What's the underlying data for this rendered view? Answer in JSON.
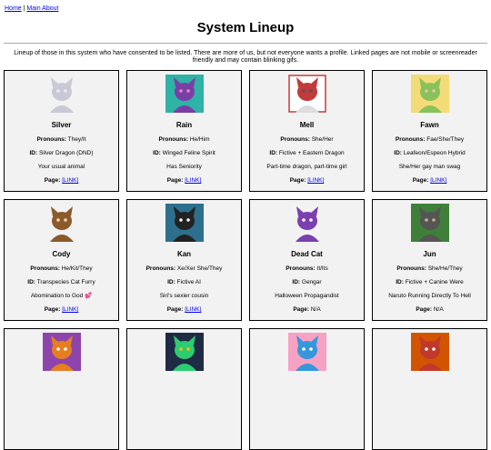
{
  "nav": {
    "home": "Home",
    "separator": "|",
    "main_about": "Main About"
  },
  "title": "System Lineup",
  "intro": "Lineup of those in this system who have consented to be listed. There are more of us, but not everyone wants a profile. Linked pages are not mobile or screenreader friendly and may contain blinking gifs.",
  "labels": {
    "pronouns": "Pronouns:",
    "id": "ID:",
    "page": "Page:"
  },
  "members": [
    {
      "name": "Silver",
      "pronouns": "They/It",
      "id": "Silver Dragon (DND)",
      "note": "Your usual animal",
      "page": "[LINK]",
      "page_is_link": true,
      "avatar_colors": [
        "#3b2f6e",
        "#c9c9d6",
        "#e8e8f0"
      ]
    },
    {
      "name": "Rain",
      "pronouns": "He/Him",
      "id": "Winged Feline Spirit",
      "note": "Has Seniority",
      "page": "[LINK]",
      "page_is_link": true,
      "avatar_colors": [
        "#2fb3a7",
        "#7a3fa6",
        "#e58ac0"
      ]
    },
    {
      "name": "Mell",
      "pronouns": "She/Her",
      "id": "Fictive + Eastern Dragon",
      "note": "Part-time dragon, part-time girl",
      "page": "[LINK]",
      "page_is_link": true,
      "avatar_colors": [
        "#ffffff",
        "#c23a3a",
        "#555555"
      ]
    },
    {
      "name": "Fawn",
      "pronouns": "Fae/She/They",
      "id": "Leafeon/Espeon Hybrid",
      "note": "She/Her gay man swag",
      "page": "[LINK]",
      "page_is_link": true,
      "avatar_colors": [
        "#f3dc77",
        "#8ac25a",
        "#e0c6a8"
      ]
    },
    {
      "name": "Cody",
      "pronouns": "He/Kit/They",
      "id": "Transpecies Cat Furry",
      "note": "Abomination to God 💕",
      "page": "[LINK]",
      "page_is_link": true,
      "avatar_colors": [
        "#c0392b",
        "#8b5a2b",
        "#f5d6b0"
      ]
    },
    {
      "name": "Kan",
      "pronouns": "Xe/Xer She/They",
      "id": "Fictive AI",
      "note": "Siri's sexier cousin",
      "page": "[LINK]",
      "page_is_link": true,
      "avatar_colors": [
        "#2e6f8e",
        "#222222",
        "#f2f2f2"
      ]
    },
    {
      "name": "Dead Cat",
      "pronouns": "It/Its",
      "id": "Gengar",
      "note": "Halloween Propagandist",
      "page": "N/A",
      "page_is_link": false,
      "avatar_colors": [
        "#5b2a86",
        "#7b3fb0",
        "#ffffff"
      ]
    },
    {
      "name": "Jun",
      "pronouns": "She/He/They",
      "id": "Fictive + Canine Were",
      "note": "Naruto Running Directly To Hell",
      "page": "N/A",
      "page_is_link": false,
      "avatar_colors": [
        "#3f7f3a",
        "#555555",
        "#c8b28a"
      ]
    },
    {
      "name": "",
      "pronouns": "",
      "id": "",
      "note": "",
      "page": "",
      "page_is_link": false,
      "avatar_colors": [
        "#8e44ad",
        "#e67e22",
        "#ffffff"
      ]
    },
    {
      "name": "",
      "pronouns": "",
      "id": "",
      "note": "",
      "page": "",
      "page_is_link": false,
      "avatar_colors": [
        "#1f2a44",
        "#2ecc71",
        "#f1c40f"
      ]
    },
    {
      "name": "",
      "pronouns": "",
      "id": "",
      "note": "",
      "page": "",
      "page_is_link": false,
      "avatar_colors": [
        "#f7a1c4",
        "#3498db",
        "#ffffff"
      ]
    },
    {
      "name": "",
      "pronouns": "",
      "id": "",
      "note": "",
      "page": "",
      "page_is_link": false,
      "avatar_colors": [
        "#d35400",
        "#c0392b",
        "#ffffff"
      ]
    }
  ]
}
